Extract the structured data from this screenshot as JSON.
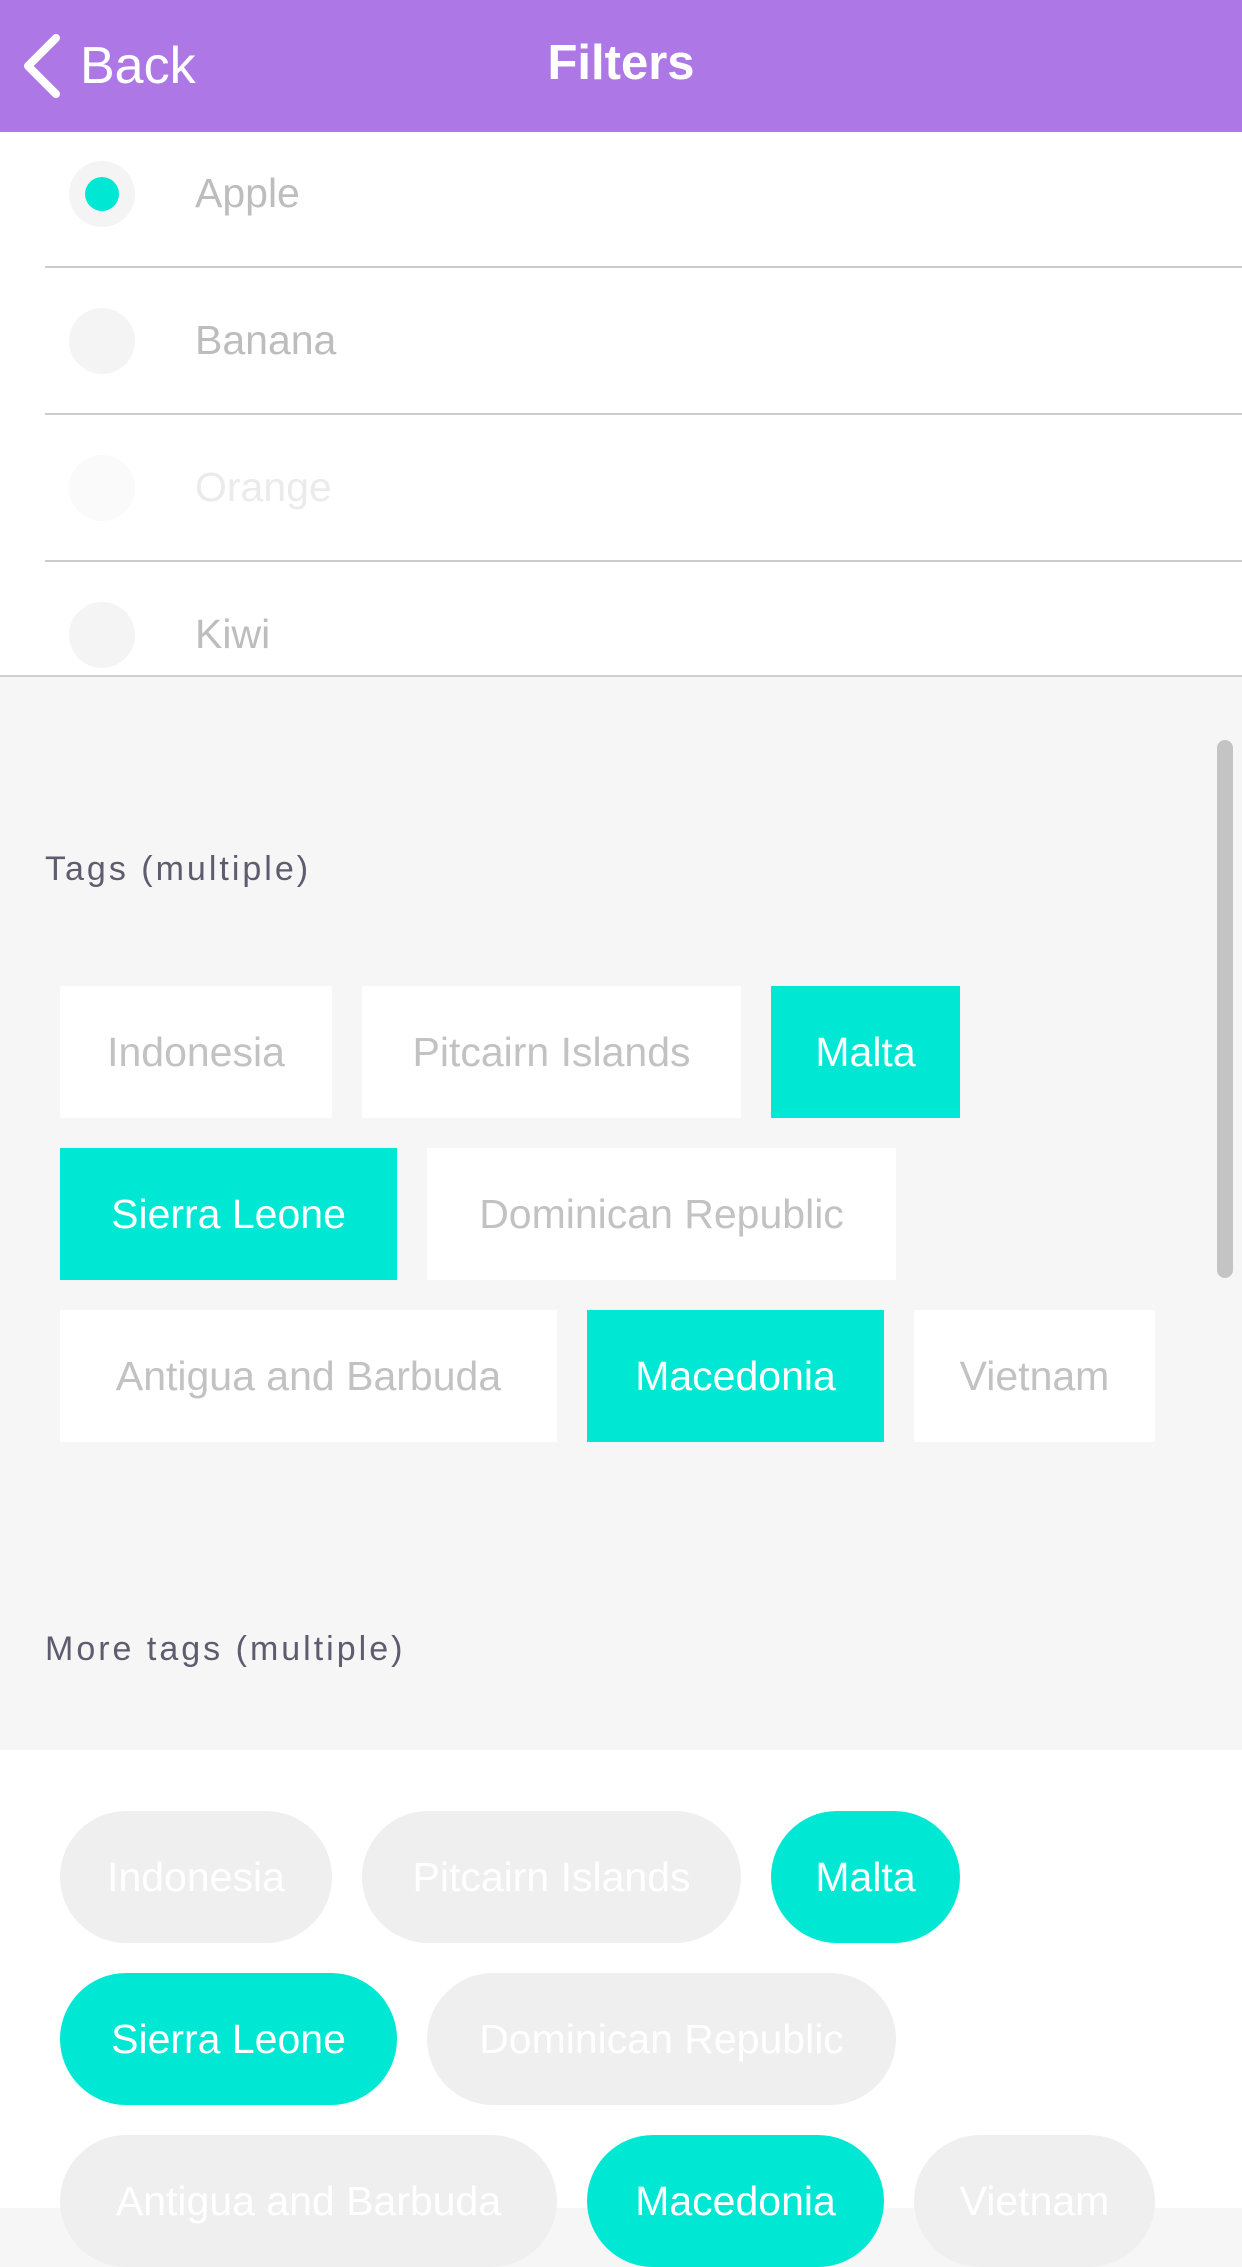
{
  "nav": {
    "back_label": "Back",
    "title": "Filters"
  },
  "radio_options": [
    {
      "label": "Apple",
      "selected": true
    },
    {
      "label": "Banana",
      "selected": false
    },
    {
      "label": "Orange",
      "selected": false
    },
    {
      "label": "Kiwi",
      "selected": false
    }
  ],
  "tags_section": {
    "title": "Tags (multiple)",
    "tags": [
      {
        "label": "Indonesia",
        "selected": false
      },
      {
        "label": "Pitcairn Islands",
        "selected": false
      },
      {
        "label": "Malta",
        "selected": true
      },
      {
        "label": "Sierra Leone",
        "selected": true
      },
      {
        "label": "Dominican Republic",
        "selected": false
      },
      {
        "label": "Antigua and Barbuda",
        "selected": false
      },
      {
        "label": "Macedonia",
        "selected": true
      },
      {
        "label": "Vietnam",
        "selected": false
      }
    ]
  },
  "more_tags_section": {
    "title": "More tags (multiple)",
    "tags": [
      {
        "label": "Indonesia",
        "selected": false
      },
      {
        "label": "Pitcairn Islands",
        "selected": false
      },
      {
        "label": "Malta",
        "selected": true
      },
      {
        "label": "Sierra Leone",
        "selected": true
      },
      {
        "label": "Dominican Republic",
        "selected": false
      },
      {
        "label": "Antigua and Barbuda",
        "selected": false
      },
      {
        "label": "Macedonia",
        "selected": true
      },
      {
        "label": "Vietnam",
        "selected": false
      }
    ]
  },
  "colors": {
    "nav_background": "#ad78e6",
    "accent": "#00e8d4",
    "page_background": "#f6f6f6"
  },
  "icons": {
    "back": "chevron-left-icon"
  }
}
